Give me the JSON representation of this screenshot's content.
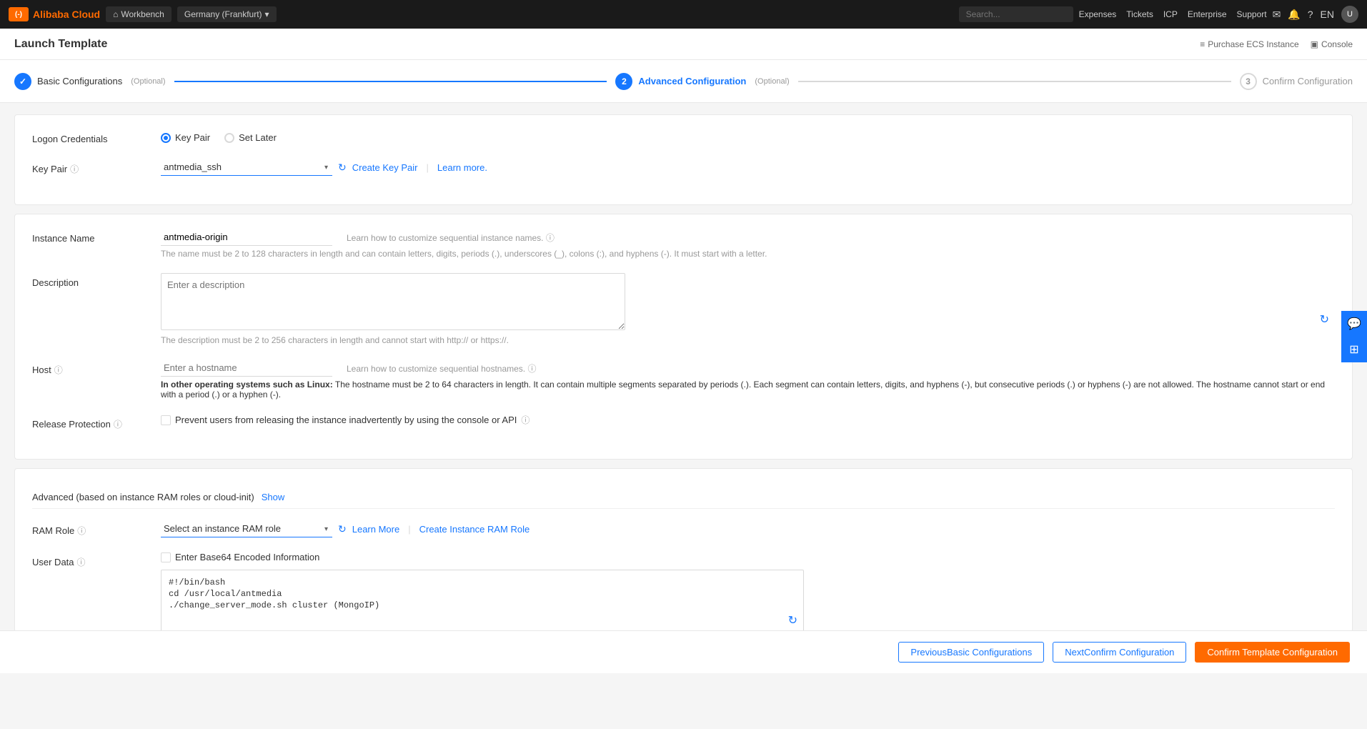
{
  "app": {
    "logo_text": "(-)",
    "brand_name": "Alibaba Cloud"
  },
  "top_nav": {
    "workbench_label": "Workbench",
    "region_label": "Germany (Frankfurt)",
    "region_arrow": "▾",
    "search_placeholder": "Search...",
    "nav_links": [
      "Expenses",
      "Tickets",
      "ICP",
      "Enterprise",
      "Support"
    ],
    "lang": "EN"
  },
  "sub_nav": {
    "page_title": "Launch Template",
    "purchase_label": "Purchase ECS Instance",
    "console_label": "Console"
  },
  "steps": [
    {
      "number": "✓",
      "label": "Basic Configurations",
      "sublabel": "(Optional)",
      "state": "done"
    },
    {
      "number": "2",
      "label": "Advanced Configuration",
      "sublabel": "(Optional)",
      "state": "active"
    },
    {
      "number": "3",
      "label": "Confirm Configuration",
      "sublabel": "",
      "state": "inactive"
    }
  ],
  "logon_credentials": {
    "label": "Logon Credentials",
    "options": [
      "Key Pair",
      "Set Later"
    ],
    "selected": "Key Pair"
  },
  "key_pair": {
    "label": "Key Pair",
    "value": "antmedia_ssh",
    "create_label": "Create Key Pair",
    "learn_more_label": "Learn more."
  },
  "instance_name": {
    "label": "Instance Name",
    "value": "antmedia-origin",
    "learn_label": "Learn how to customize sequential instance names.",
    "hint": "The name must be 2 to 128 characters in length and can contain letters, digits, periods (.), underscores (_), colons (:), and hyphens (-). It must start with a letter."
  },
  "description": {
    "label": "Description",
    "placeholder": "Enter a description",
    "hint": "The description must be 2 to 256 characters in length and cannot start with http:// or https://."
  },
  "host": {
    "label": "Host",
    "placeholder": "Enter a hostname",
    "learn_label": "Learn how to customize sequential hostnames.",
    "hint_bold": "In other operating systems such as Linux:",
    "hint": " The hostname must be 2 to 64 characters in length. It can contain multiple segments separated by periods (.). Each segment can contain letters, digits, and hyphens (-), but consecutive periods (.) or hyphens (-) are not allowed. The hostname cannot start or end with a period (.) or a hyphen (-)."
  },
  "release_protection": {
    "label": "Release Protection",
    "checkbox_label": "Prevent users from releasing the instance inadvertently by using the console or API"
  },
  "advanced_section": {
    "header": "Advanced (based on instance RAM roles or cloud-init)",
    "show_label": "Show"
  },
  "ram_role": {
    "label": "RAM Role",
    "placeholder": "Select an instance RAM role",
    "learn_more_label": "Learn More",
    "create_label": "Create Instance RAM Role"
  },
  "user_data": {
    "label": "User Data",
    "checkbox_label": "Enter Base64 Encoded Information",
    "code_line1": "#!/bin/bash",
    "code_line2": "cd /usr/local/antmedia",
    "code_line3": "./change_server_mode.sh cluster (MongoIP)"
  },
  "bottom_bar": {
    "prev_label": "Previous",
    "prev_sub": "Basic Configurations",
    "next_label": "Next",
    "next_sub": "Confirm Configuration",
    "confirm_label": "Confirm Template Configuration"
  },
  "right_panel": {
    "chat_icon": "💬",
    "grid_icon": "⊞"
  }
}
